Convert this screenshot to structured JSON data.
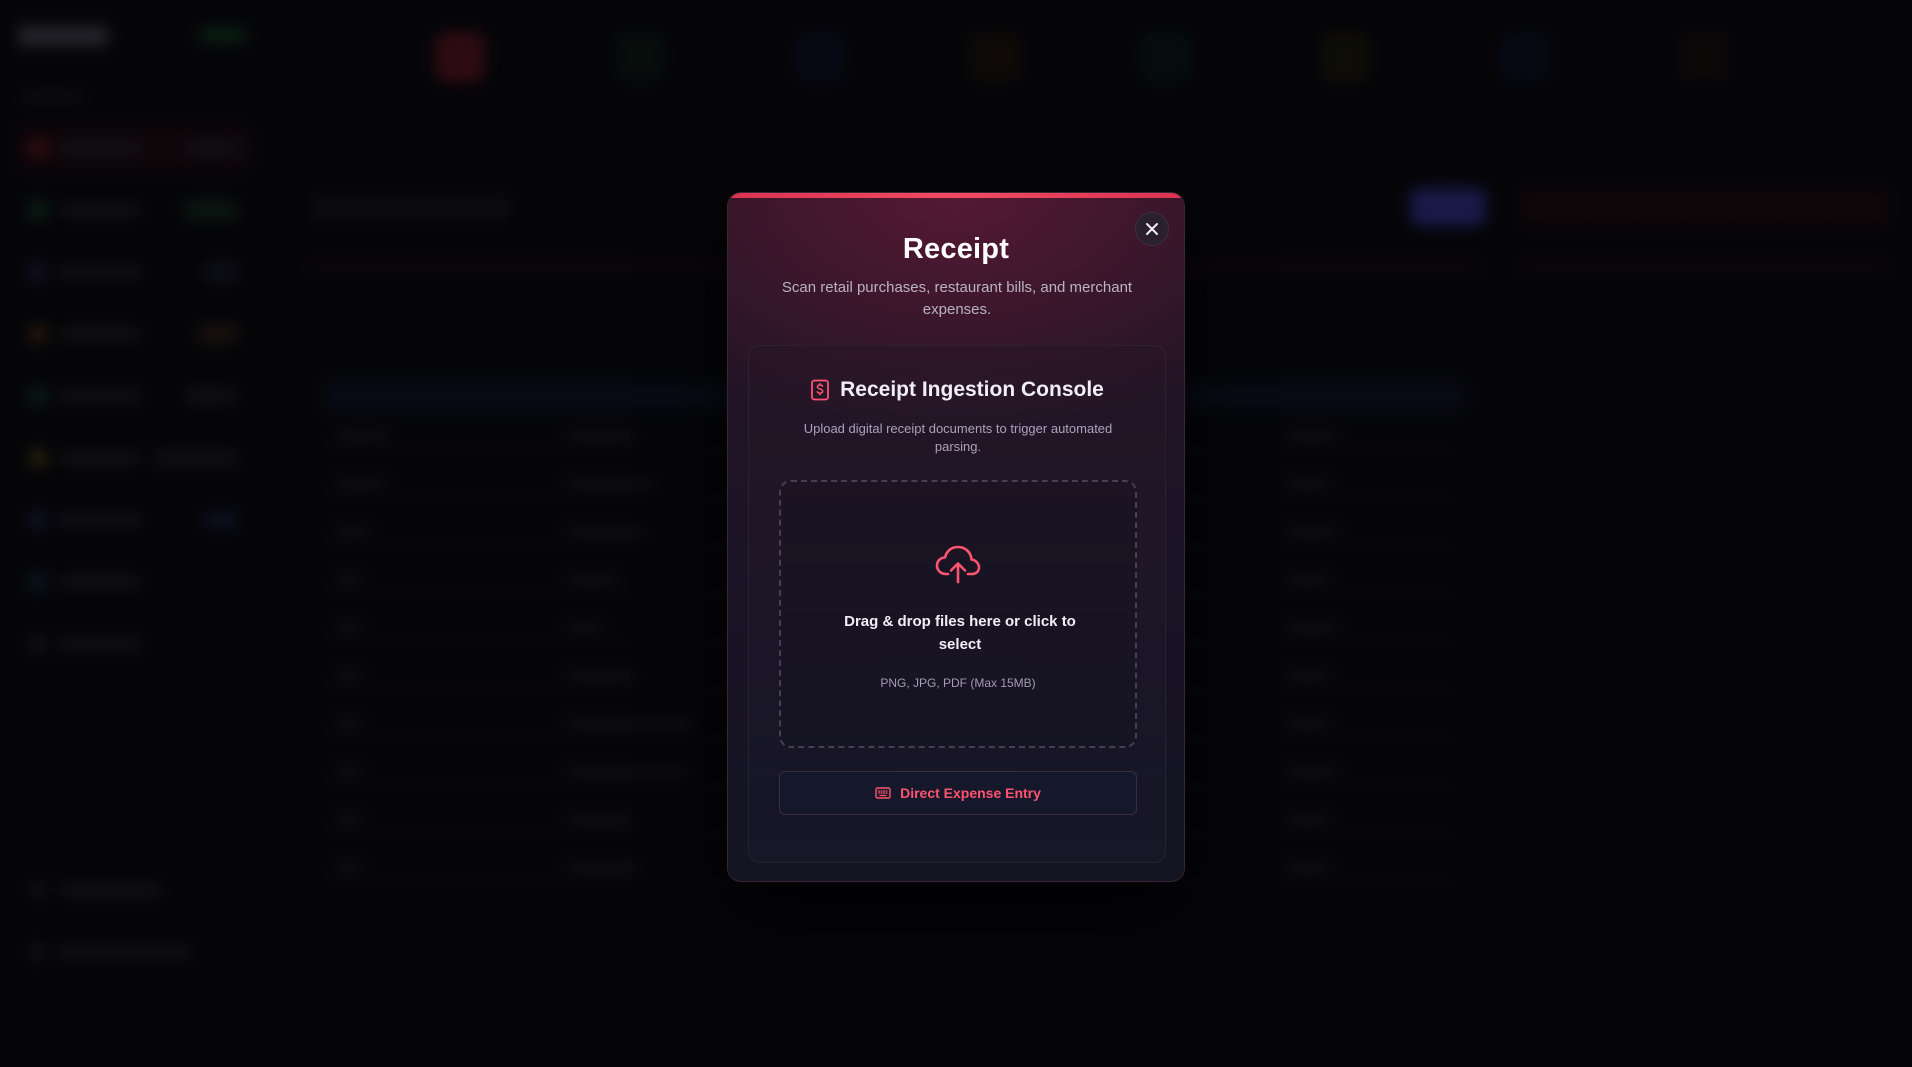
{
  "modal": {
    "title": "Receipt",
    "subtitle": "Scan retail purchases, restaurant bills, and merchant expenses.",
    "close_icon": "close-icon"
  },
  "console": {
    "icon": "receipt-dollar-icon",
    "title": "Receipt Ingestion Console",
    "description": "Upload digital receipt documents to trigger automated parsing."
  },
  "dropzone": {
    "icon": "cloud-upload-icon",
    "label": "Drag & drop files here or click to select",
    "hint": "PNG, JPG, PDF (Max 15MB)"
  },
  "direct_entry": {
    "icon": "keyboard-icon",
    "label": "Direct Expense Entry"
  },
  "colors": {
    "accent": "#f24a64",
    "modal_bg": "#1c1426",
    "text_primary": "#ffffff",
    "text_muted": "#b9b3c4"
  }
}
